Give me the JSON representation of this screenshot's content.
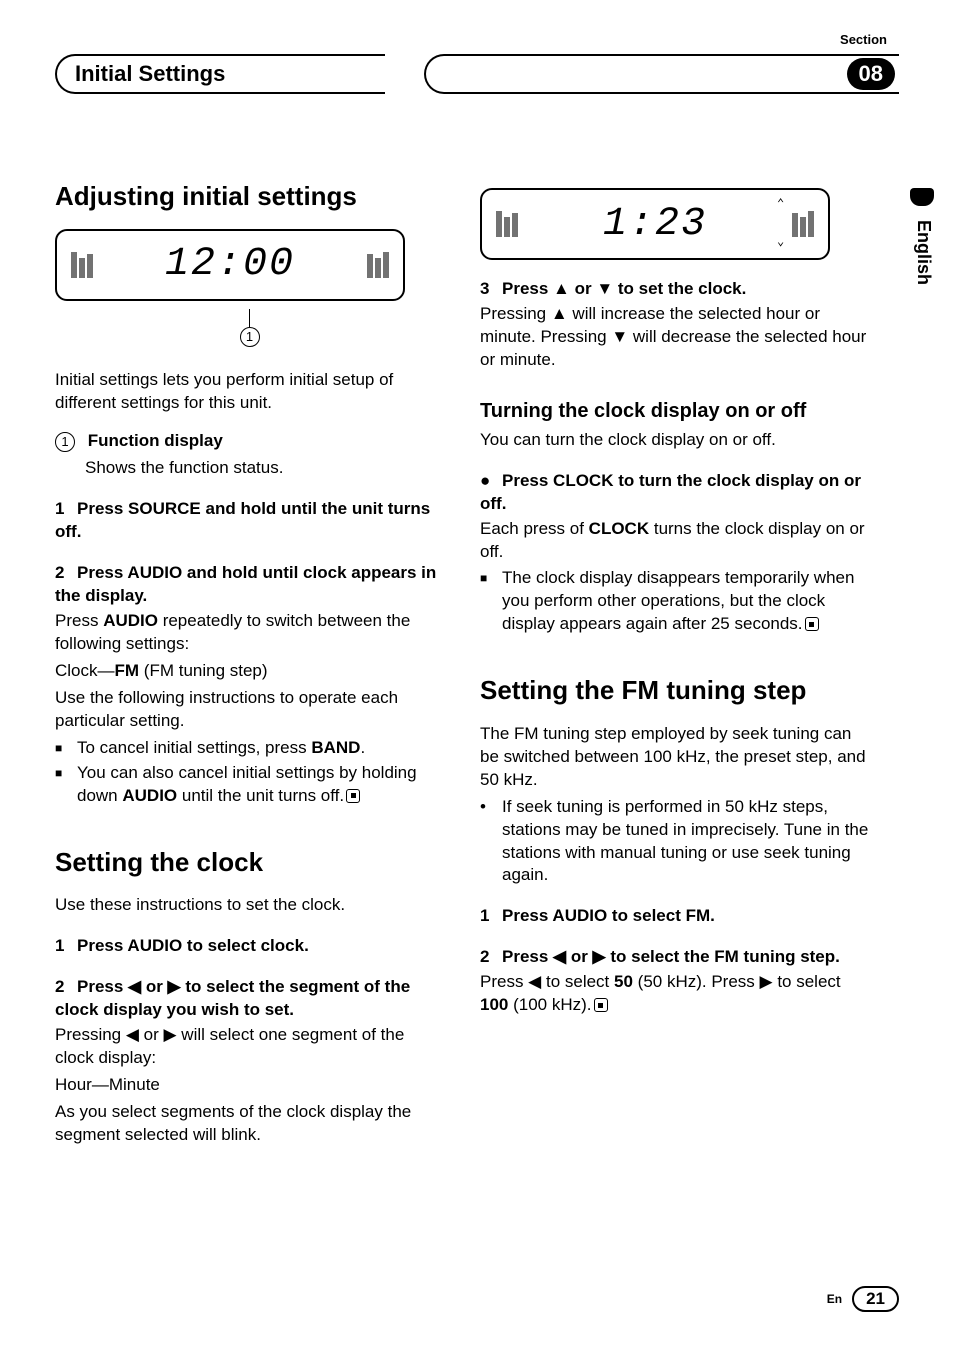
{
  "header": {
    "section_label": "Section",
    "chapter_title": "Initial Settings",
    "section_number": "08",
    "side_tab": "English"
  },
  "left": {
    "h1": "Adjusting initial settings",
    "display_time": "12:00",
    "callout_num": "1",
    "intro": "Initial settings lets you perform initial setup of different settings for this unit.",
    "fn_num": "1",
    "fn_title": "Function display",
    "fn_desc": "Shows the function status.",
    "step1": "Press SOURCE and hold until the unit turns off.",
    "step2": "Press AUDIO and hold until clock appears in the display.",
    "step2_line1a": "Press ",
    "step2_line1b": "AUDIO",
    "step2_line1c": " repeatedly to switch between the following settings:",
    "step2_line2a": "Clock—",
    "step2_line2b": "FM",
    "step2_line2c": " (FM tuning step)",
    "step2_line3": "Use the following instructions to operate each particular setting.",
    "bullet1a": "To cancel initial settings, press ",
    "bullet1b": "BAND",
    "bullet1c": ".",
    "bullet2a": "You can also cancel initial settings by holding down ",
    "bullet2b": "AUDIO",
    "bullet2c": " until the unit turns off.",
    "h1b": "Setting the clock",
    "clock_intro": "Use these instructions to set the clock.",
    "cstep1": "Press AUDIO to select clock.",
    "cstep2": "Press ◀ or ▶ to select the segment of the clock display you wish to set.",
    "cstep2_body": "Pressing ◀ or ▶ will select one segment of the clock display:",
    "cstep2_seg": "Hour—Minute",
    "cstep2_note": "As you select segments of the clock display the segment selected will blink."
  },
  "right": {
    "display_time": "1:23",
    "step3": "Press ▲ or ▼ to set the clock.",
    "step3_body": "Pressing ▲ will increase the selected hour or minute. Pressing ▼ will decrease the selected hour or minute.",
    "h2": "Turning the clock display on or off",
    "h2_intro": "You can turn the clock display on or off.",
    "bstep": "Press CLOCK to turn the clock display on or off.",
    "bstep_body_a": "Each press of ",
    "bstep_body_b": "CLOCK",
    "bstep_body_c": " turns the clock display on or off.",
    "note1": "The clock display disappears temporarily when you perform other operations, but the clock display appears again after 25 seconds.",
    "h1c": "Setting the FM tuning step",
    "fm_intro": "The FM tuning step employed by seek tuning can be switched between 100 kHz, the preset step, and 50 kHz.",
    "fm_note": "If seek tuning is performed in 50 kHz steps, stations may be tuned in imprecisely. Tune in the stations with manual tuning or use seek tuning again.",
    "fstep1": "Press AUDIO to select FM.",
    "fstep2": "Press ◀ or ▶ to select the FM tuning step.",
    "fstep2_body_a": "Press ◀ to select ",
    "fstep2_body_b": "50",
    "fstep2_body_c": " (50 kHz). Press ▶ to select ",
    "fstep2_body_d": "100",
    "fstep2_body_e": " (100 kHz)."
  },
  "footer": {
    "lang": "En",
    "page": "21"
  }
}
